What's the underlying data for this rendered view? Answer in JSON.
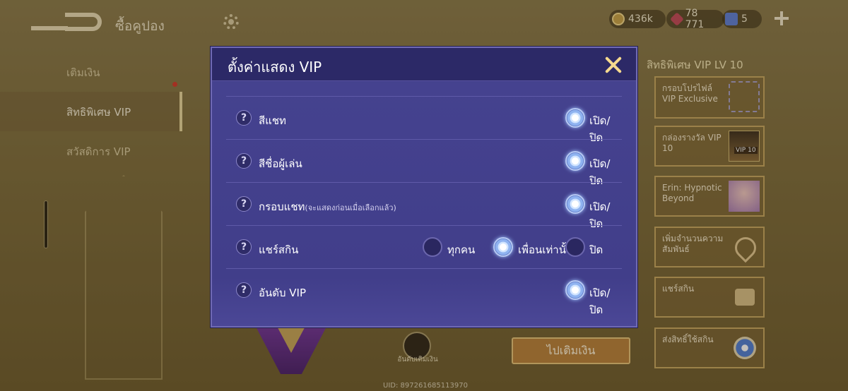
{
  "header": {
    "title": "ซื้อคูปอง"
  },
  "resources": {
    "gold": "436k",
    "diamonds": "78 771",
    "tickets": "5"
  },
  "sidebar": {
    "items": [
      {
        "label": "เติมเงิน"
      },
      {
        "label": "สิทธิพิเศษ VIP"
      },
      {
        "label": "สวัสดิการ VIP"
      }
    ]
  },
  "right_panel": {
    "title": "สิทธิพิเศษ VIP LV 10",
    "perks": [
      {
        "label": "กรอบโปรไฟล์ VIP Exclusive"
      },
      {
        "label": "กล่องรางวัล VIP 10",
        "badge": "VIP 10"
      },
      {
        "label": "Erin: Hypnotic Beyond"
      },
      {
        "label": "เพิ่มจำนวนความสัมพันธ์"
      },
      {
        "label": "แชร์สกิน"
      },
      {
        "label": "ส่งสิทธิ์ใช้สกิน"
      }
    ]
  },
  "bottom": {
    "rank_label": "อันดับเติมเงิน",
    "topup_button": "ไปเติมเงิน",
    "uid": "UID: 897261685113970"
  },
  "modal": {
    "title": "ตั้งค่าแสดง VIP",
    "help_glyph": "?",
    "rows": [
      {
        "label": "สีแชท",
        "toggle_label": "เปิด/ปิด",
        "on": true
      },
      {
        "label": "สีชื่อผู้เล่น",
        "toggle_label": "เปิด/ปิด",
        "on": true
      },
      {
        "label": "กรอบแชท",
        "sublabel": "(จะแสดงก่อนเมื่อเลือกแล้ว)",
        "toggle_label": "เปิด/ปิด",
        "on": true
      },
      {
        "label": "แชร์สกิน",
        "options": [
          "ทุกคน",
          "เพื่อนเท่านั้น",
          "ปิด"
        ],
        "selected": "เพื่อนเท่านั้น"
      },
      {
        "label": "อันดับ VIP",
        "toggle_label": "เปิด/ปิด",
        "on": true
      }
    ]
  }
}
